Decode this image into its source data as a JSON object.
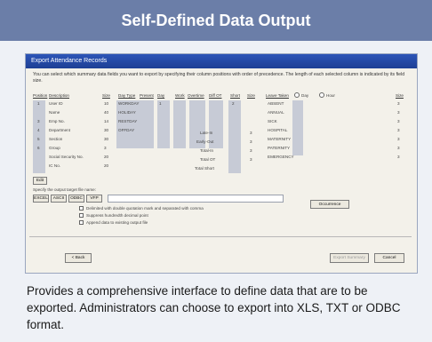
{
  "banner_title": "Self-Defined Data Output",
  "window": {
    "title": "Export Attendance Records",
    "intro": "You can select which summary data fields you want to export by specifying their column positions with order of  precedence.  The length of each selected column is indicated by its field size."
  },
  "headers": {
    "position": "Position",
    "description": "Description",
    "size": "Size",
    "daytype": "Day Type",
    "present": "Present",
    "day": "Day",
    "work": "Work",
    "overtime": "Overtime",
    "diffot": "Diff OT",
    "short": "Short",
    "size2": "Size",
    "leave": "Leave Taken",
    "size3": "Size"
  },
  "rows": [
    {
      "pos": "1",
      "desc": "User ID",
      "size": "10",
      "daytype": "WORKDAY",
      "v": "1",
      "short": "2",
      "leave": "ABSENT",
      "ls": "3"
    },
    {
      "pos": "",
      "desc": "Name",
      "size": "40",
      "daytype": "HOLIDAY",
      "v": "",
      "short": "",
      "leave": "ANNUAL",
      "ls": "3"
    },
    {
      "pos": "3",
      "desc": "Emp No.",
      "size": "14",
      "daytype": "RESTDAY",
      "v": "",
      "short": "",
      "leave": "SICK",
      "ls": "3"
    },
    {
      "pos": "4",
      "desc": "Department",
      "size": "30",
      "daytype": "OFFDAY",
      "v": "",
      "short": "",
      "leave": "HOSPITAL",
      "ls": "3"
    },
    {
      "pos": "5",
      "desc": "Section",
      "size": "30",
      "daytype": "",
      "v": "",
      "short": "",
      "leave": "MATERNITY",
      "ls": "3"
    },
    {
      "pos": "6",
      "desc": "Group",
      "size": "3",
      "daytype": "",
      "v": "",
      "short": "",
      "leave": "PATERNITY",
      "ls": "3"
    },
    {
      "pos": "",
      "desc": "Social Security No.",
      "size": "20",
      "daytype": "",
      "v": "",
      "short": "",
      "leave": "EMERGENCY",
      "ls": "3"
    },
    {
      "pos": "",
      "desc": "IC No.",
      "size": "20",
      "daytype": "",
      "v": "",
      "short": "",
      "leave": "",
      "ls": ""
    }
  ],
  "mid_labels": [
    "Late-In",
    "Early-Out",
    "Total-In",
    "Total OT",
    "Total Short"
  ],
  "mid_values": [
    "3",
    "3",
    "3",
    "3"
  ],
  "radios": {
    "day": "Day",
    "hour": "Hour"
  },
  "edit_label": "Edit",
  "spec_label": "Specify the output target file name:",
  "format_buttons": [
    "EXCEL",
    "ASCII",
    "ODBC",
    "VFP"
  ],
  "options": [
    "Delimited with double quotation mark and separated with comma",
    "Suppress hundredth decimal point",
    "Append data to existing output file"
  ],
  "occurrence_label": "Occurrence",
  "footer": {
    "back": "< Back",
    "export": "Export Summary",
    "cancel": "Cancel"
  },
  "caption": "Provides a comprehensive interface to define data that are to be exported. Administrators can choose to export into XLS, TXT or ODBC format."
}
